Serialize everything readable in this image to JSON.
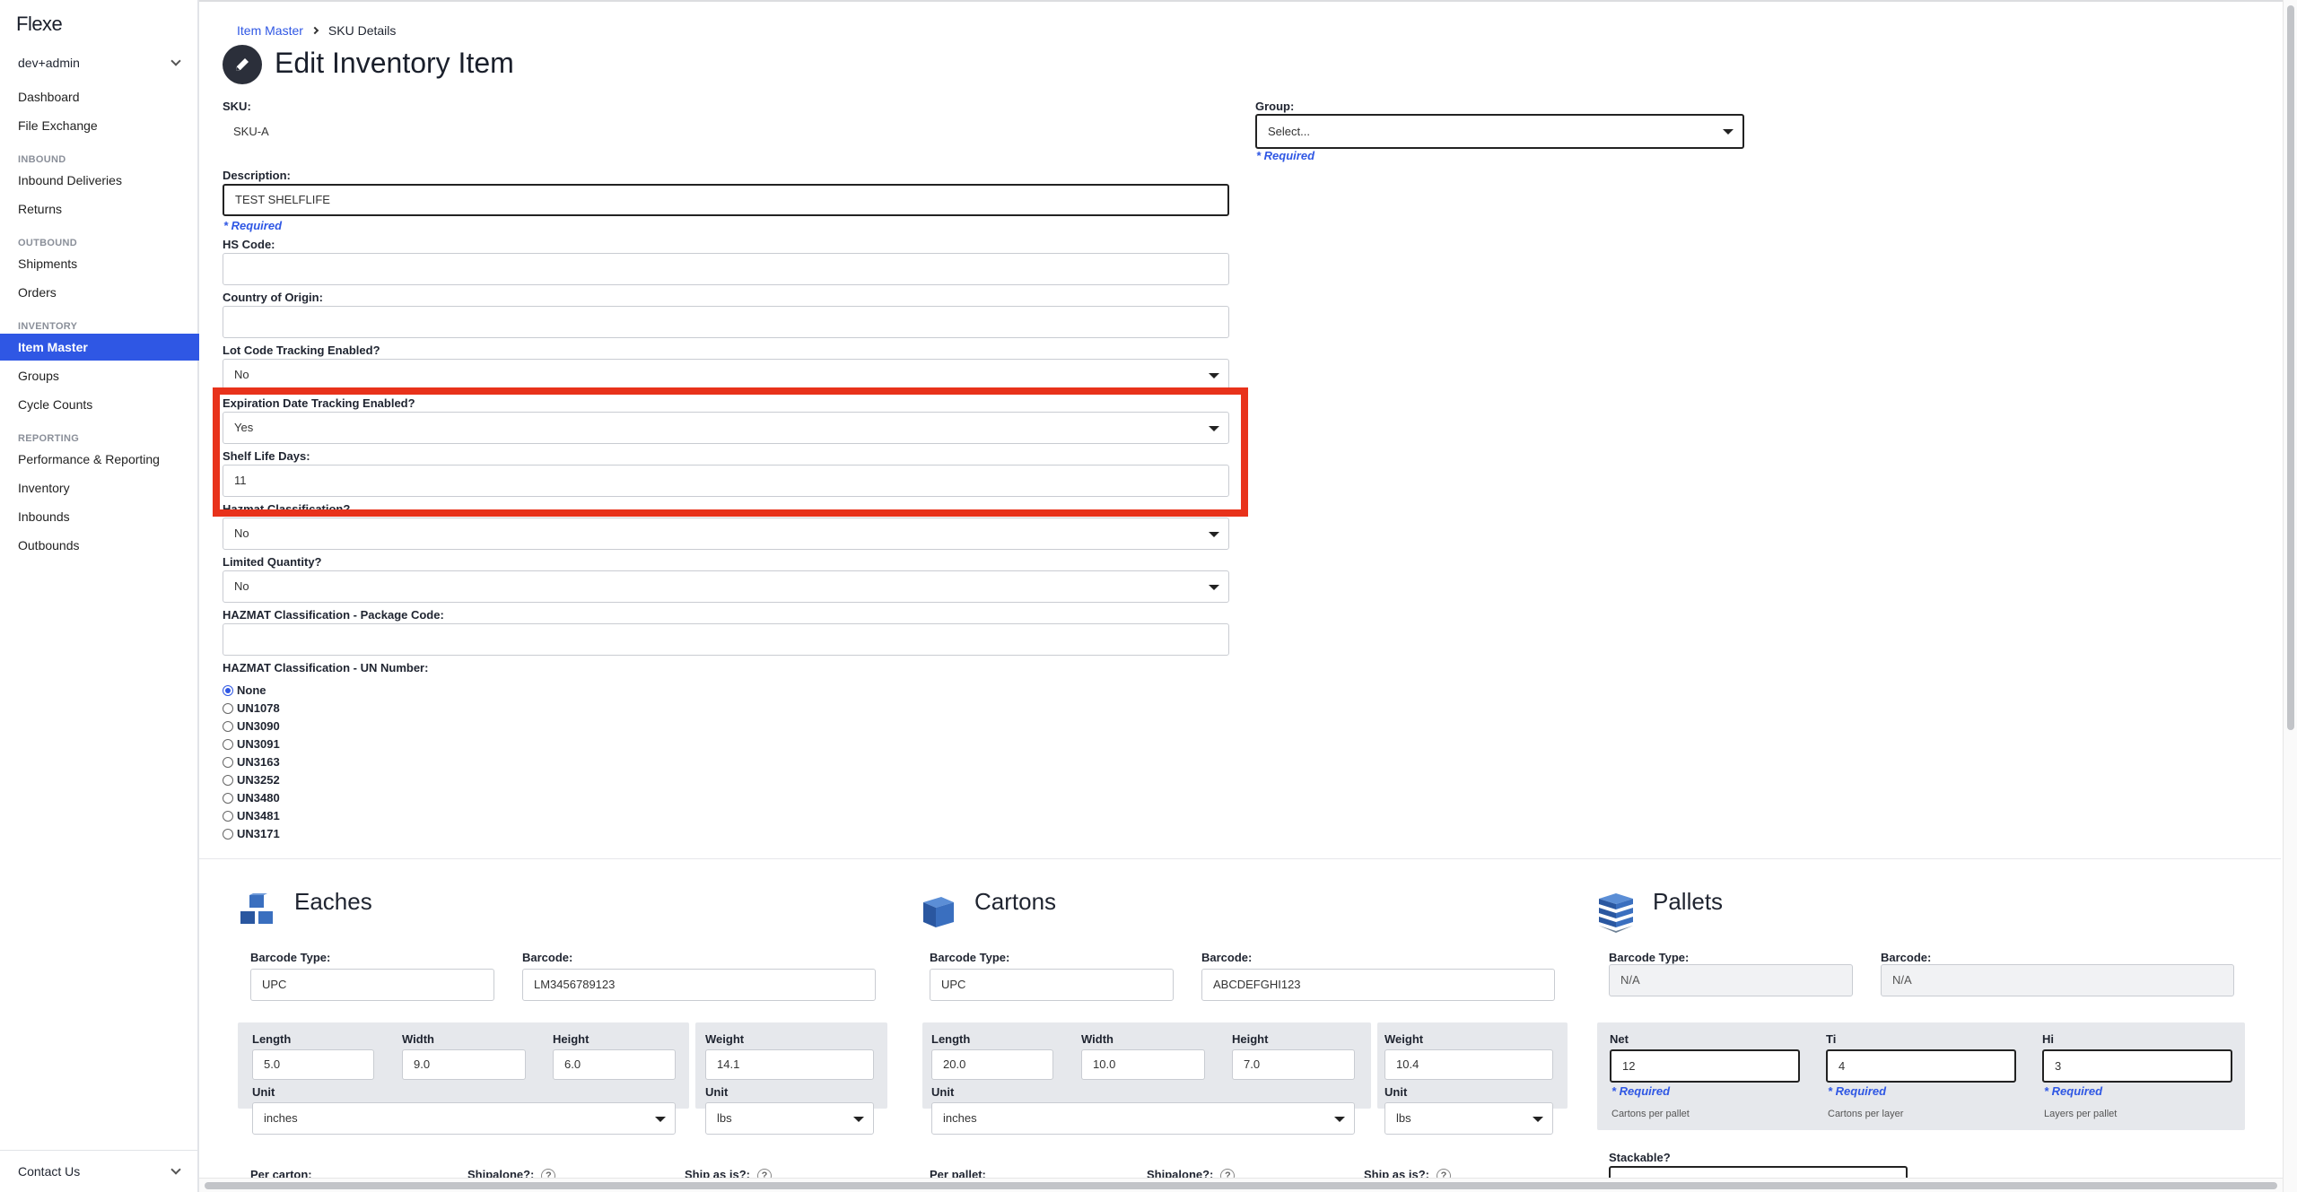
{
  "sidebar": {
    "logo": "Flexe",
    "account": "dev+admin",
    "items": [
      {
        "label": "Dashboard"
      },
      {
        "label": "File Exchange"
      }
    ],
    "sections": [
      {
        "title": "INBOUND",
        "items": [
          "Inbound Deliveries",
          "Returns"
        ]
      },
      {
        "title": "OUTBOUND",
        "items": [
          "Shipments",
          "Orders"
        ]
      },
      {
        "title": "INVENTORY",
        "items": [
          "Item Master",
          "Groups",
          "Cycle Counts"
        ]
      },
      {
        "title": "REPORTING",
        "items": [
          "Performance & Reporting",
          "Inventory",
          "Inbounds",
          "Outbounds"
        ]
      }
    ],
    "active_item": "Item Master",
    "contact": "Contact Us"
  },
  "breadcrumb": {
    "parent": "Item Master",
    "current": "SKU Details"
  },
  "page": {
    "title": "Edit Inventory Item"
  },
  "form": {
    "sku_label": "SKU:",
    "sku_value": "SKU-A",
    "group_label": "Group:",
    "group_value": "Select...",
    "required_text": "* Required",
    "description_label": "Description:",
    "description_value": "TEST SHELFLIFE",
    "hs_code_label": "HS Code:",
    "hs_code_value": "",
    "country_label": "Country of Origin:",
    "country_value": "",
    "lot_label": "Lot Code Tracking Enabled?",
    "lot_value": "No",
    "expiration_label": "Expiration Date Tracking Enabled?",
    "expiration_value": "Yes",
    "shelf_life_label": "Shelf Life Days:",
    "shelf_life_value": "11",
    "hazmat_label": "Hazmat Classification?",
    "hazmat_value": "No",
    "limited_label": "Limited Quantity?",
    "limited_value": "No",
    "package_code_label": "HAZMAT Classification - Package Code:",
    "package_code_value": "",
    "un_label": "HAZMAT Classification - UN Number:",
    "un_options": [
      "None",
      "UN1078",
      "UN3090",
      "UN3091",
      "UN3163",
      "UN3252",
      "UN3480",
      "UN3481",
      "UN3171"
    ],
    "un_selected": "None"
  },
  "eaches": {
    "title": "Eaches",
    "barcode_type_label": "Barcode Type:",
    "barcode_type": "UPC",
    "barcode_label": "Barcode:",
    "barcode": "LM3456789123",
    "length_label": "Length",
    "length": "5.0",
    "width_label": "Width",
    "width": "9.0",
    "height_label": "Height",
    "height": "6.0",
    "weight_label": "Weight",
    "weight": "14.1",
    "unit_label": "Unit",
    "dim_unit": "inches",
    "weight_unit": "lbs",
    "per_label": "Per carton:",
    "shipalone_label": "Shipalone?:",
    "shipasis_label": "Ship as is?:"
  },
  "cartons": {
    "title": "Cartons",
    "barcode_type_label": "Barcode Type:",
    "barcode_type": "UPC",
    "barcode_label": "Barcode:",
    "barcode": "ABCDEFGHI123",
    "length_label": "Length",
    "length": "20.0",
    "width_label": "Width",
    "width": "10.0",
    "height_label": "Height",
    "height": "7.0",
    "weight_label": "Weight",
    "weight": "10.4",
    "unit_label": "Unit",
    "dim_unit": "inches",
    "weight_unit": "lbs",
    "per_label": "Per pallet:",
    "shipalone_label": "Shipalone?:",
    "shipasis_label": "Ship as is?:"
  },
  "pallets": {
    "title": "Pallets",
    "barcode_type_label": "Barcode Type:",
    "barcode_type": "N/A",
    "barcode_label": "Barcode:",
    "barcode": "N/A",
    "net_label": "Net",
    "net": "12",
    "net_hint": "Cartons per pallet",
    "ti_label": "Ti",
    "ti": "4",
    "ti_hint": "Cartons per layer",
    "hi_label": "Hi",
    "hi": "3",
    "hi_hint": "Layers per pallet",
    "required_text": "* Required",
    "stackable_label": "Stackable?"
  },
  "help_glyph": "?"
}
